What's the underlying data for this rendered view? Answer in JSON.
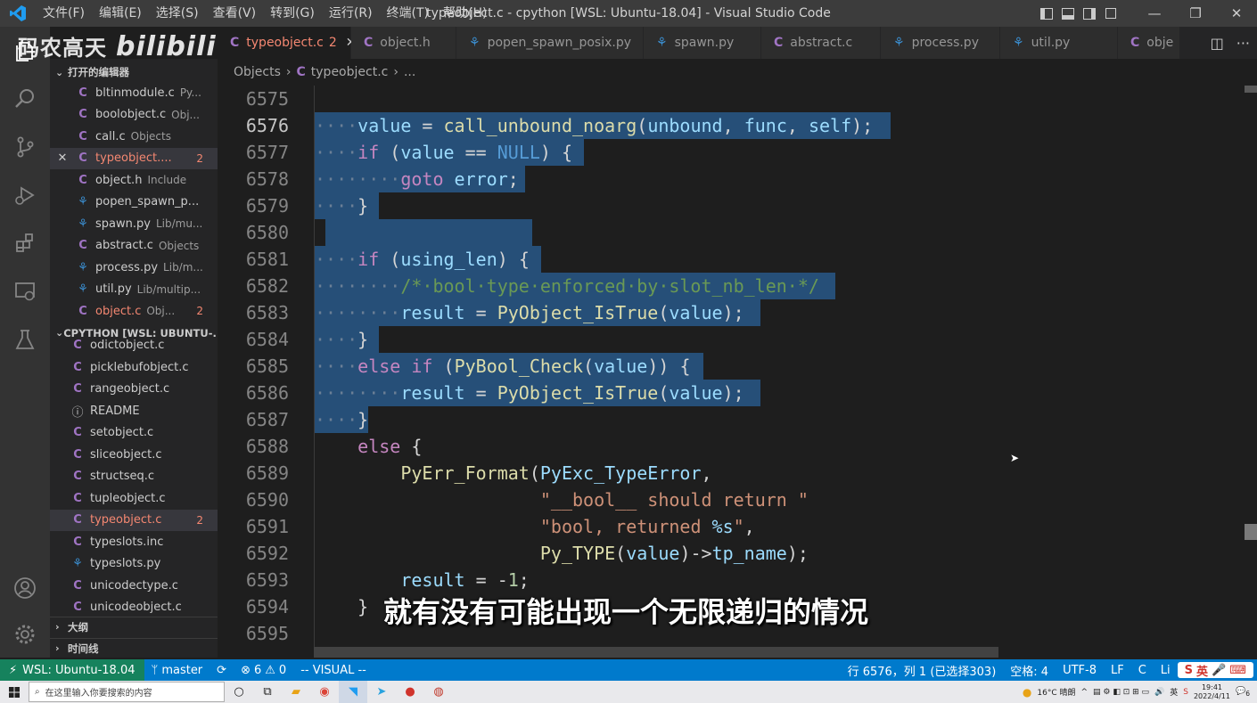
{
  "window": {
    "title": "typeobject.c - cpython [WSL: Ubuntu-18.04] - Visual Studio Code"
  },
  "menu": [
    "文件(F)",
    "编辑(E)",
    "选择(S)",
    "查看(V)",
    "转到(G)",
    "运行(R)",
    "终端(T)",
    "帮助(H)"
  ],
  "watermark": {
    "text": "码农高天",
    "brand": "bilibili"
  },
  "tabs": [
    {
      "label": "typeobject.c",
      "badge": "2",
      "icon": "C"
    },
    {
      "label": "object.h",
      "icon": "C"
    },
    {
      "label": "popen_spawn_posix.py",
      "icon": "py"
    },
    {
      "label": "spawn.py",
      "icon": "py"
    },
    {
      "label": "abstract.c",
      "icon": "C"
    },
    {
      "label": "process.py",
      "icon": "py"
    },
    {
      "label": "util.py",
      "icon": "py"
    },
    {
      "label": "obje",
      "icon": "C"
    }
  ],
  "breadcrumb": {
    "folder": "Objects",
    "file": "typeobject.c",
    "more": "..."
  },
  "sidebar": {
    "open_editors": {
      "title": "打开的编辑器",
      "items": [
        {
          "name": "bltinmodule.c",
          "desc": "Py...",
          "icon": "C"
        },
        {
          "name": "boolobject.c",
          "desc": "Obj...",
          "icon": "C"
        },
        {
          "name": "call.c",
          "desc": "Objects",
          "icon": "C"
        },
        {
          "name": "typeobject....",
          "desc": "",
          "icon": "C",
          "badge": "2",
          "error": true,
          "selected": true
        },
        {
          "name": "object.h",
          "desc": "Include",
          "icon": "C"
        },
        {
          "name": "popen_spawn_p...",
          "desc": "",
          "icon": "py"
        },
        {
          "name": "spawn.py",
          "desc": "Lib/mu...",
          "icon": "py"
        },
        {
          "name": "abstract.c",
          "desc": "Objects",
          "icon": "C"
        },
        {
          "name": "process.py",
          "desc": "Lib/m...",
          "icon": "py"
        },
        {
          "name": "util.py",
          "desc": "Lib/multip...",
          "icon": "py"
        },
        {
          "name": "object.c",
          "desc": "Obj...",
          "icon": "C",
          "badge": "2",
          "error": true
        }
      ]
    },
    "workspace": {
      "title": "CPYTHON [WSL: UBUNTU-...",
      "items": [
        {
          "name": "odictobject.c",
          "icon": "C"
        },
        {
          "name": "picklebufobject.c",
          "icon": "C"
        },
        {
          "name": "rangeobject.c",
          "icon": "C"
        },
        {
          "name": "README",
          "icon": "info"
        },
        {
          "name": "setobject.c",
          "icon": "C"
        },
        {
          "name": "sliceobject.c",
          "icon": "C"
        },
        {
          "name": "structseq.c",
          "icon": "C"
        },
        {
          "name": "tupleobject.c",
          "icon": "C"
        },
        {
          "name": "typeobject.c",
          "icon": "C",
          "badge": "2",
          "error": true,
          "selected": true
        },
        {
          "name": "typeslots.inc",
          "icon": "C"
        },
        {
          "name": "typeslots.py",
          "icon": "py"
        },
        {
          "name": "unicodectype.c",
          "icon": "C"
        },
        {
          "name": "unicodeobject.c",
          "icon": "C"
        }
      ]
    },
    "outline": "大纲",
    "timeline": "时间线"
  },
  "editor": {
    "current_line": "6576",
    "lines": [
      {
        "n": "6575",
        "sel": false,
        "html": ""
      },
      {
        "n": "6576",
        "sel": true,
        "html": "<span class='ws'>·</span><span class='ws'>···</span><span class='v'>value</span> = <span class='f'>call_unbound_noarg</span>(<span class='v'>unbound</span>, <span class='v'>func</span>, <span class='v'>self</span>);"
      },
      {
        "n": "6577",
        "sel": true,
        "html": "<span class='ws'>····</span><span class='k'>if</span> (<span class='v'>value</span> == <span class='b'>NULL</span>) {"
      },
      {
        "n": "6578",
        "sel": true,
        "html": "<span class='ws'>········</span><span class='k'>goto</span> <span class='v'>error</span>;"
      },
      {
        "n": "6579",
        "sel": true,
        "html": "<span class='ws'>····</span>}"
      },
      {
        "n": "6580",
        "sel": true,
        "html": ""
      },
      {
        "n": "6581",
        "sel": true,
        "html": "<span class='ws'>····</span><span class='k'>if</span> (<span class='v'>using_len</span>) {"
      },
      {
        "n": "6582",
        "sel": true,
        "html": "<span class='ws'>········</span><span class='cm'>/*·bool·type·enforced·by·slot_nb_len·*/</span>"
      },
      {
        "n": "6583",
        "sel": true,
        "html": "<span class='ws'>········</span><span class='v'>result</span> = <span class='f'>PyObject_IsTrue</span>(<span class='v'>value</span>);"
      },
      {
        "n": "6584",
        "sel": true,
        "html": "<span class='ws'>····</span>}"
      },
      {
        "n": "6585",
        "sel": true,
        "html": "<span class='ws'>····</span><span class='k'>else</span> <span class='k'>if</span> (<span class='f'>PyBool_Check</span>(<span class='v'>value</span>)) {"
      },
      {
        "n": "6586",
        "sel": true,
        "html": "<span class='ws'>········</span><span class='v'>result</span> = <span class='f'>PyObject_IsTrue</span>(<span class='v'>value</span>);"
      },
      {
        "n": "6587",
        "sel": true,
        "html": "<span class='ws'>····</span>}"
      },
      {
        "n": "6588",
        "sel": false,
        "html": "    <span class='k'>else</span> {"
      },
      {
        "n": "6589",
        "sel": false,
        "html": "        <span class='f'>PyErr_Format</span>(<span class='v'>PyExc_TypeError</span>,"
      },
      {
        "n": "6590",
        "sel": false,
        "html": "                     <span class='s'>\"__bool__ should return \"</span>"
      },
      {
        "n": "6591",
        "sel": false,
        "html": "                     <span class='s'>\"bool, returned </span><span class='v'>%s</span><span class='s'>\"</span>,"
      },
      {
        "n": "6592",
        "sel": false,
        "html": "                     <span class='f'>Py_TYPE</span>(<span class='v'>value</span>)-><span class='v'>tp_name</span>);"
      },
      {
        "n": "6593",
        "sel": false,
        "html": "        <span class='v'>result</span> = -<span class='n'>1</span>;"
      },
      {
        "n": "6594",
        "sel": false,
        "html": "    }"
      },
      {
        "n": "6595",
        "sel": false,
        "html": ""
      }
    ],
    "subtitle": "就有没有可能出现一个无限递归的情况"
  },
  "statusbar": {
    "remote": "WSL: Ubuntu-18.04",
    "branch": "master",
    "errors": "6",
    "warnings": "0",
    "mode": "-- VISUAL --",
    "position": "行 6576，列 1 (已选择303)",
    "spaces": "空格: 4",
    "encoding": "UTF-8",
    "eol": "LF",
    "language": "C",
    "extra": "Li"
  },
  "taskbar": {
    "search_placeholder": "在这里输入你要搜索的内容",
    "weather": "16°C 晴朗",
    "ime": "英",
    "time": "19:41",
    "date": "2022/4/11",
    "notifications": "6"
  }
}
